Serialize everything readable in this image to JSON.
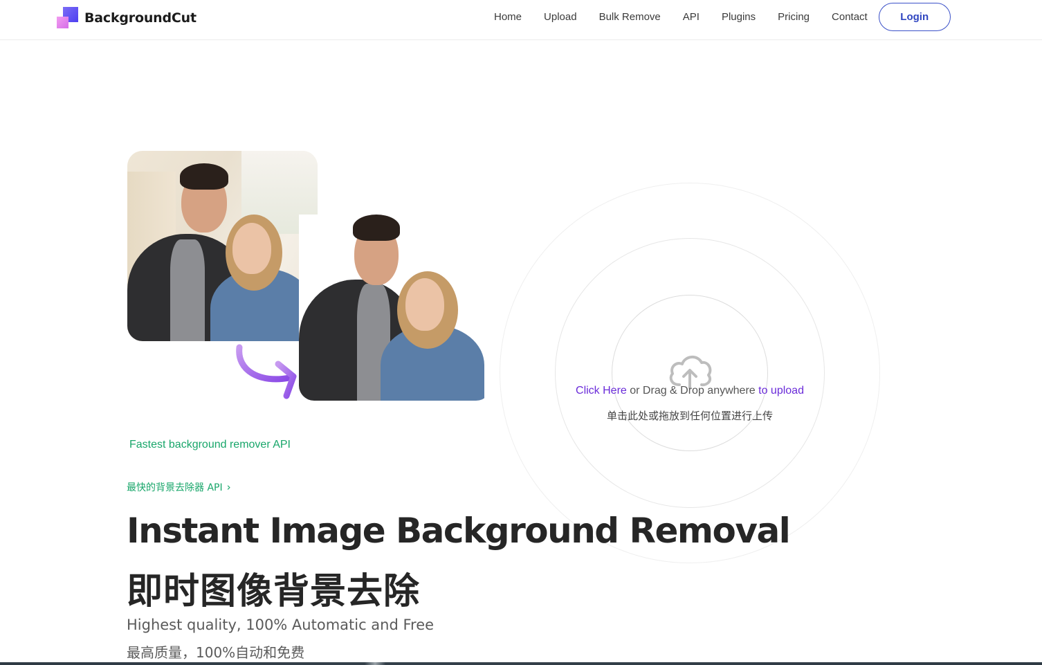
{
  "brand": {
    "name": "BackgroundCut"
  },
  "nav": {
    "links": [
      "Home",
      "Upload",
      "Bulk Remove",
      "API",
      "Plugins",
      "Pricing",
      "Contact"
    ],
    "login_label": "Login"
  },
  "upload": {
    "click_here": "Click Here",
    "middle": " or Drag & Drop anywhere ",
    "to_upload": "to upload",
    "cn": "单击此处或拖放到任何位置进行上传",
    "icon": "cloud-upload-icon"
  },
  "hero": {
    "tagline_en": "Fastest background remover API",
    "tagline_cn": "最快的背景去除器 API",
    "title_en": "Instant Image Background Removal",
    "title_cn": "即时图像背景去除",
    "subtitle_en": "Highest quality, 100% Automatic and Free",
    "subtitle_cn": "最高质量，100%自动和免费"
  },
  "colors": {
    "accent_purple": "#6a2bd9",
    "accent_green": "#18a66a",
    "login_blue": "#2f45c0"
  }
}
